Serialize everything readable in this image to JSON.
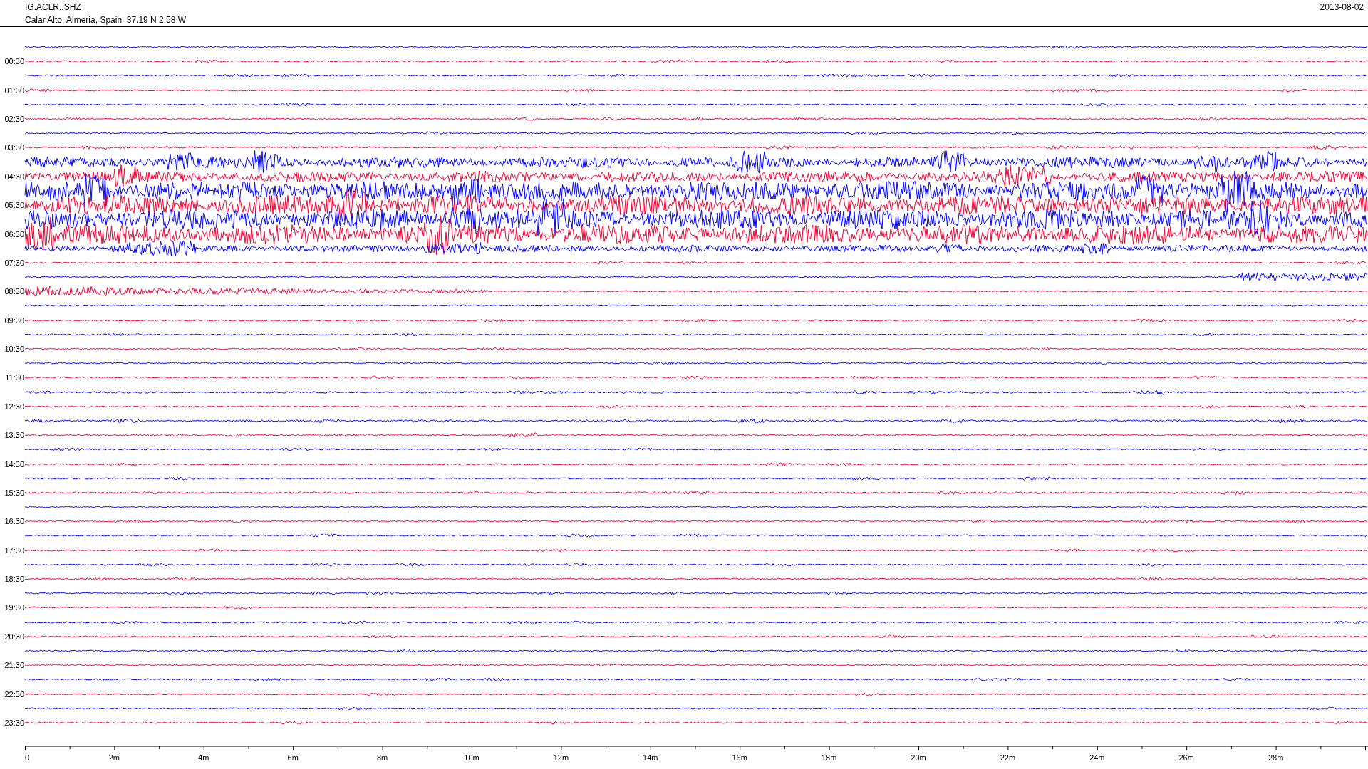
{
  "header": {
    "station": "IG.ACLR..SHZ",
    "location": "Calar Alto, Almeria, Spain  37.19 N 2.58 W",
    "date": "2013-08-02"
  },
  "traces": [
    {
      "color": "#0000ff",
      "kind": "quiet"
    },
    {
      "label": "00:30",
      "color": "#ee0033",
      "kind": "quiet"
    },
    {
      "color": "#0000ff",
      "kind": "quiet"
    },
    {
      "label": "01:30",
      "color": "#ee0033",
      "kind": "quiet"
    },
    {
      "color": "#0000ff",
      "kind": "quiet"
    },
    {
      "label": "02:30",
      "color": "#ee0033",
      "kind": "quiet"
    },
    {
      "color": "#0000ff",
      "kind": "quiet"
    },
    {
      "label": "03:30",
      "color": "#ee0033",
      "kind": "mild"
    },
    {
      "color": "#0000ff",
      "kind": "strong"
    },
    {
      "label": "04:30",
      "color": "#ee0033",
      "kind": "strong"
    },
    {
      "color": "#0000ff",
      "kind": "intense"
    },
    {
      "label": "05:30",
      "color": "#ee0033",
      "kind": "intense"
    },
    {
      "color": "#0000ff",
      "kind": "intense"
    },
    {
      "label": "06:30",
      "color": "#ee0033",
      "kind": "intense"
    },
    {
      "color": "#0000ff",
      "kind": "moderate"
    },
    {
      "label": "07:30",
      "color": "#ee0033",
      "kind": "quiet"
    },
    {
      "color": "#0000ff",
      "kind": "tail-burst"
    },
    {
      "label": "08:30",
      "color": "#ee0033",
      "kind": "head-burst"
    },
    {
      "color": "#0000ff",
      "kind": "quiet"
    },
    {
      "label": "09:30",
      "color": "#ee0033",
      "kind": "quiet"
    },
    {
      "color": "#0000ff",
      "kind": "quiet"
    },
    {
      "label": "10:30",
      "color": "#ee0033",
      "kind": "quiet"
    },
    {
      "color": "#0000ff",
      "kind": "quiet"
    },
    {
      "label": "11:30",
      "color": "#ee0033",
      "kind": "quiet"
    },
    {
      "color": "#0000ff",
      "kind": "mild"
    },
    {
      "label": "12:30",
      "color": "#ee0033",
      "kind": "quiet"
    },
    {
      "color": "#0000ff",
      "kind": "mild"
    },
    {
      "label": "13:30",
      "color": "#ee0033",
      "kind": "mild"
    },
    {
      "color": "#0000ff",
      "kind": "quiet"
    },
    {
      "label": "14:30",
      "color": "#ee0033",
      "kind": "quiet"
    },
    {
      "color": "#0000ff",
      "kind": "quiet"
    },
    {
      "label": "15:30",
      "color": "#ee0033",
      "kind": "mild"
    },
    {
      "color": "#0000ff",
      "kind": "quiet"
    },
    {
      "label": "16:30",
      "color": "#ee0033",
      "kind": "quiet"
    },
    {
      "color": "#0000ff",
      "kind": "quiet"
    },
    {
      "label": "17:30",
      "color": "#ee0033",
      "kind": "quiet"
    },
    {
      "color": "#0000ff",
      "kind": "quiet"
    },
    {
      "label": "18:30",
      "color": "#ee0033",
      "kind": "quiet"
    },
    {
      "color": "#0000ff",
      "kind": "quiet"
    },
    {
      "label": "19:30",
      "color": "#ee0033",
      "kind": "quiet"
    },
    {
      "color": "#0000ff",
      "kind": "quiet"
    },
    {
      "label": "20:30",
      "color": "#ee0033",
      "kind": "quiet"
    },
    {
      "color": "#0000ff",
      "kind": "quiet"
    },
    {
      "label": "21:30",
      "color": "#ee0033",
      "kind": "quiet"
    },
    {
      "color": "#0000ff",
      "kind": "quiet"
    },
    {
      "label": "22:30",
      "color": "#ee0033",
      "kind": "quiet"
    },
    {
      "color": "#0000ff",
      "kind": "quiet"
    },
    {
      "label": "23:30",
      "color": "#ee0033",
      "kind": "quiet"
    }
  ],
  "time_axis": {
    "labels": [
      "0",
      "2m",
      "4m",
      "6m",
      "8m",
      "10m",
      "12m",
      "14m",
      "16m",
      "18m",
      "20m",
      "22m",
      "24m",
      "26m",
      "28m"
    ]
  }
}
